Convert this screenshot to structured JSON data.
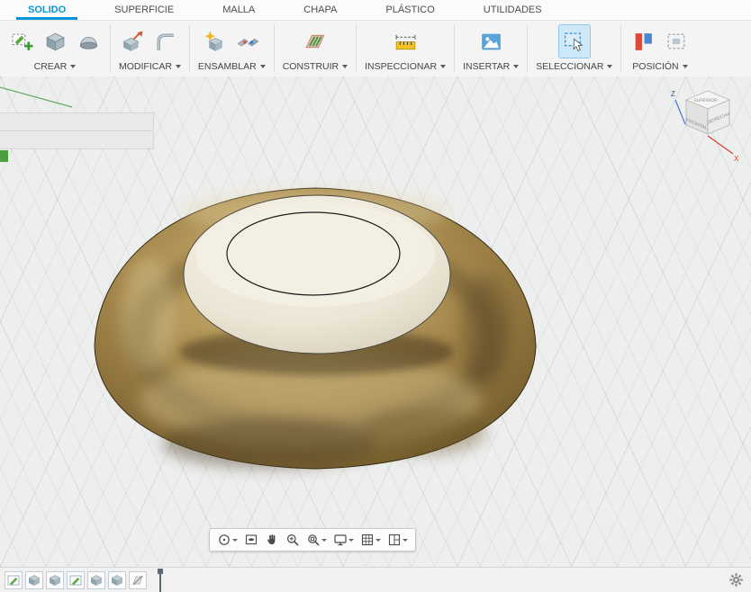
{
  "tabs": [
    {
      "label": "SOLIDO",
      "active": true
    },
    {
      "label": "SUPERFICIE",
      "active": false
    },
    {
      "label": "MALLA",
      "active": false
    },
    {
      "label": "CHAPA",
      "active": false
    },
    {
      "label": "PLÁSTICO",
      "active": false
    },
    {
      "label": "UTILIDADES",
      "active": false
    }
  ],
  "toolbar": {
    "groups": [
      {
        "label": "CREAR",
        "icons": [
          "create-sketch-icon",
          "extrude-icon",
          "revolve-icon"
        ]
      },
      {
        "label": "MODIFICAR",
        "icons": [
          "press-pull-icon",
          "fillet-icon"
        ]
      },
      {
        "label": "ENSAMBLAR",
        "icons": [
          "new-component-icon",
          "joint-icon"
        ]
      },
      {
        "label": "CONSTRUIR",
        "icons": [
          "construction-plane-icon"
        ]
      },
      {
        "label": "INSPECCIONAR",
        "icons": [
          "measure-icon"
        ]
      },
      {
        "label": "INSERTAR",
        "icons": [
          "insert-image-icon"
        ]
      },
      {
        "label": "SELECCIONAR",
        "icons": [
          "select-icon"
        ]
      },
      {
        "label": "POSICIÓN",
        "icons": [
          "capture-position-icon",
          "revert-position-icon"
        ]
      }
    ]
  },
  "viewcube": {
    "top": "SUPERIOR",
    "front": "FRONTAL",
    "right": "DERECHA",
    "axes": {
      "z": "Z",
      "x": "X"
    }
  },
  "navbar": {
    "items": [
      "orbit",
      "look-at",
      "pan",
      "zoom",
      "fit",
      "display-settings",
      "grid-display",
      "viewports"
    ]
  },
  "timeline": {
    "features": [
      "sketch",
      "extrude",
      "extrude",
      "sketch",
      "extrude",
      "extrude",
      "suppressed-feature"
    ]
  },
  "colors": {
    "accent": "#0696d7",
    "bronze_dark": "#5a4723",
    "bronze_light": "#d8c89a",
    "dome": "#efe9dc",
    "grid_bg": "#edeeee"
  }
}
